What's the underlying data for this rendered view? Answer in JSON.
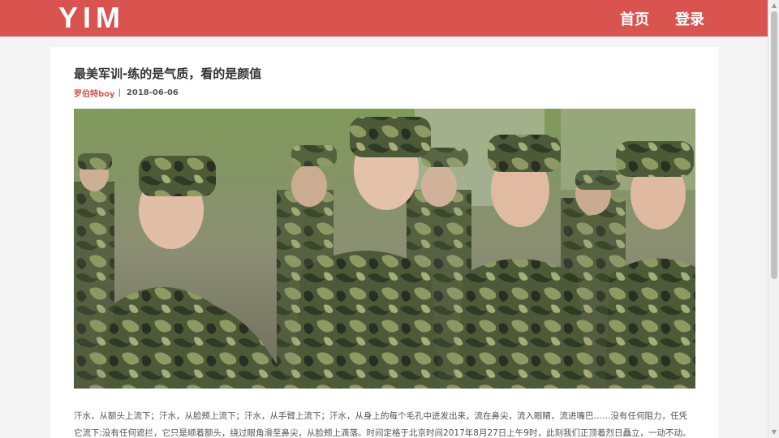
{
  "brand": {
    "logo_text": "YIM"
  },
  "nav": {
    "home": "首页",
    "login": "登录"
  },
  "article": {
    "title": "最美军训-练的是气质，看的是颜值",
    "author": "罗伯特boy",
    "separator": "|",
    "date": "2018-06-06",
    "paragraph": "汗水，从额头上流下；汗水，从脸颊上流下；汗水，从手臂上流下；汗水，从身上的每个毛孔中迸发出来，流在鼻尖，流入眼睛，流进嘴巴……没有任何阻力，任凭它流下;没有任何遮拦，它只是顺着额头，绕过眼角滑至鼻尖，从脸颊上滴落。时间定格于北京时间2017年8月27日上午9时，此刻我们正顶着烈日矗立，一动不动。我"
  },
  "colors": {
    "header": "#d9534f",
    "accent": "#d9534f",
    "background": "#f4f4f4"
  }
}
